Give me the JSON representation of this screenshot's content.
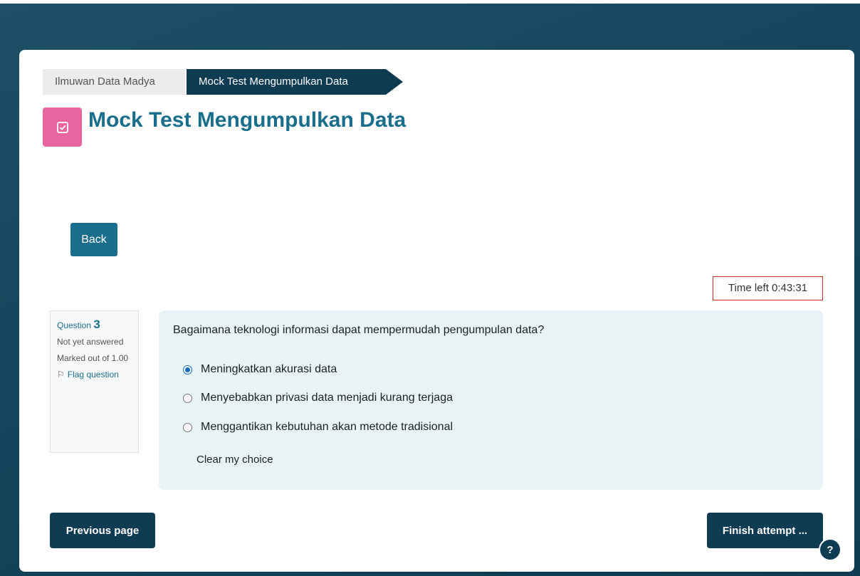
{
  "breadcrumb": {
    "items": [
      {
        "label": "Ilmuwan Data Madya"
      },
      {
        "label": "Mock Test Mengumpulkan Data"
      }
    ]
  },
  "page": {
    "title": "Mock Test Mengumpulkan Data",
    "icon": "quiz-checkbox-icon",
    "icon_color": "#e9659f",
    "title_color": "#196e8c"
  },
  "buttons": {
    "back": "Back",
    "previous_page": "Previous page",
    "finish_attempt": "Finish attempt ...",
    "help": "?"
  },
  "timer": {
    "label": "Time left 0:43:31"
  },
  "question_info": {
    "label": "Question",
    "number": "3",
    "state": "Not yet answered",
    "grade": "Marked out of 1.00",
    "flag": "Flag question"
  },
  "question": {
    "text": "Bagaimana teknologi informasi dapat mempermudah pengumpulan data?",
    "answers": [
      {
        "label": "Meningkatkan akurasi data",
        "selected": true
      },
      {
        "label": "Menyebabkan privasi data menjadi kurang terjaga",
        "selected": false
      },
      {
        "label": "Menggantikan kebutuhan akan metode tradisional",
        "selected": false
      }
    ],
    "clear_choice": "Clear my choice"
  }
}
